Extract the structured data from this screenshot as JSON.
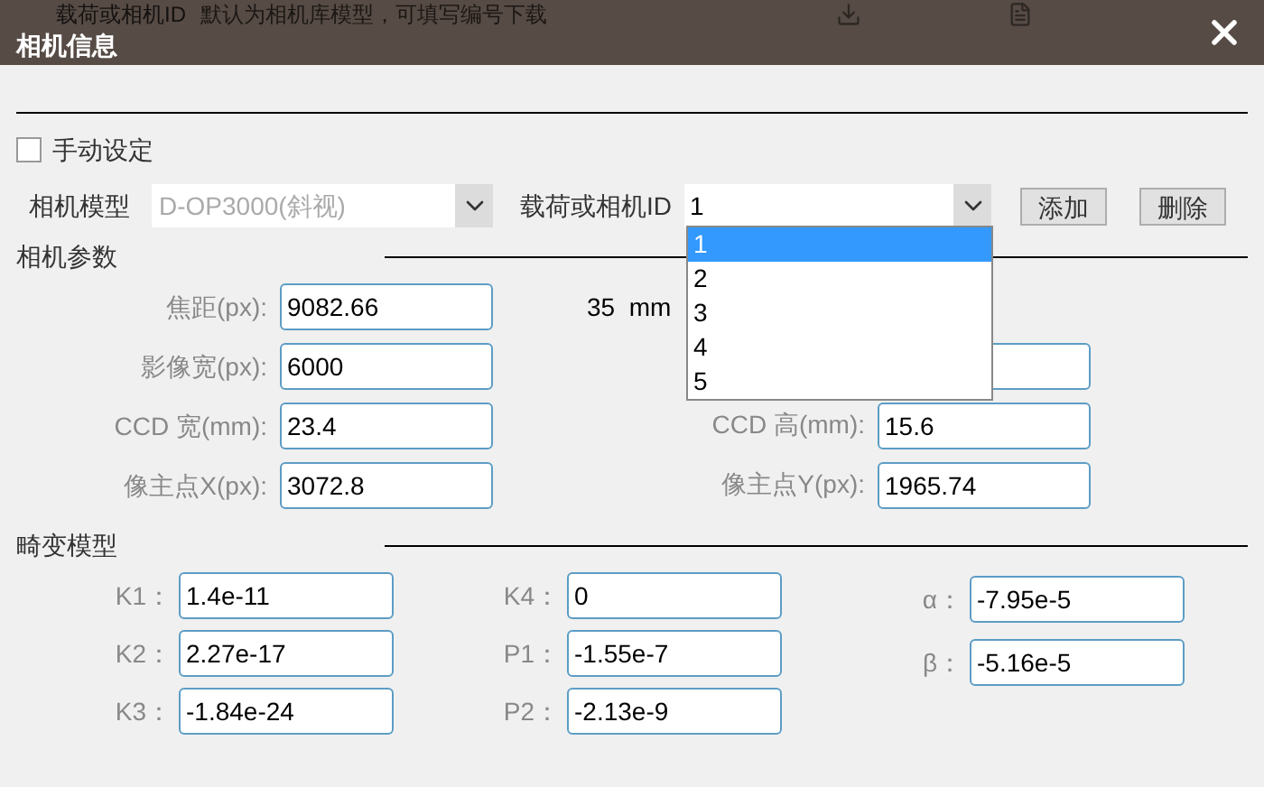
{
  "background": {
    "hint_label": "载荷或相机ID",
    "hint_text": "默认为相机库模型，可填写编号下载"
  },
  "window": {
    "title": "相机信息"
  },
  "manual": {
    "label": "手动设定",
    "checked": false
  },
  "camera_model": {
    "label": "相机模型",
    "value": "D-OP3000(斜视)",
    "disabled": true
  },
  "payload": {
    "label": "载荷或相机ID",
    "value": "1",
    "expanded": true,
    "options": [
      {
        "label": "1",
        "selected": true
      },
      {
        "label": "2",
        "selected": false
      },
      {
        "label": "3",
        "selected": false
      },
      {
        "label": "4",
        "selected": false
      },
      {
        "label": "5",
        "selected": false
      }
    ]
  },
  "buttons": [
    "添加",
    "删除"
  ],
  "camera_params": {
    "title": "相机参数",
    "rows": [
      {
        "left": {
          "label": "焦距(px):",
          "value": "9082.66"
        },
        "right": {
          "kind": "text",
          "text": "35  mm"
        }
      },
      {
        "left": {
          "label": "影像宽(px):",
          "value": "6000"
        },
        "right": {
          "kind": "field"
        }
      },
      {
        "left": {
          "label": "CCD 宽(mm):",
          "value": "23.4"
        },
        "right": {
          "kind": "field",
          "label": "CCD 高(mm):",
          "value": "15.6"
        }
      },
      {
        "left": {
          "label": "像主点X(px):",
          "value": "3072.8"
        },
        "right": {
          "kind": "field",
          "label": "像主点Y(px):",
          "value": "1965.74"
        }
      }
    ]
  },
  "distortion": {
    "title": "畸变模型",
    "columns": [
      [
        {
          "label": "K1：",
          "value": "1.4e-11"
        },
        {
          "label": "K2：",
          "value": "2.27e-17"
        },
        {
          "label": "K3：",
          "value": "-1.84e-24"
        }
      ],
      [
        {
          "label": "K4：",
          "value": "0"
        },
        {
          "label": "P1：",
          "value": "-1.55e-7"
        },
        {
          "label": "P2：",
          "value": "-2.13e-9"
        }
      ],
      [
        {
          "label": "α：",
          "value": "-7.95e-5"
        },
        {
          "label": "β：",
          "value": "-5.16e-5"
        }
      ]
    ]
  }
}
